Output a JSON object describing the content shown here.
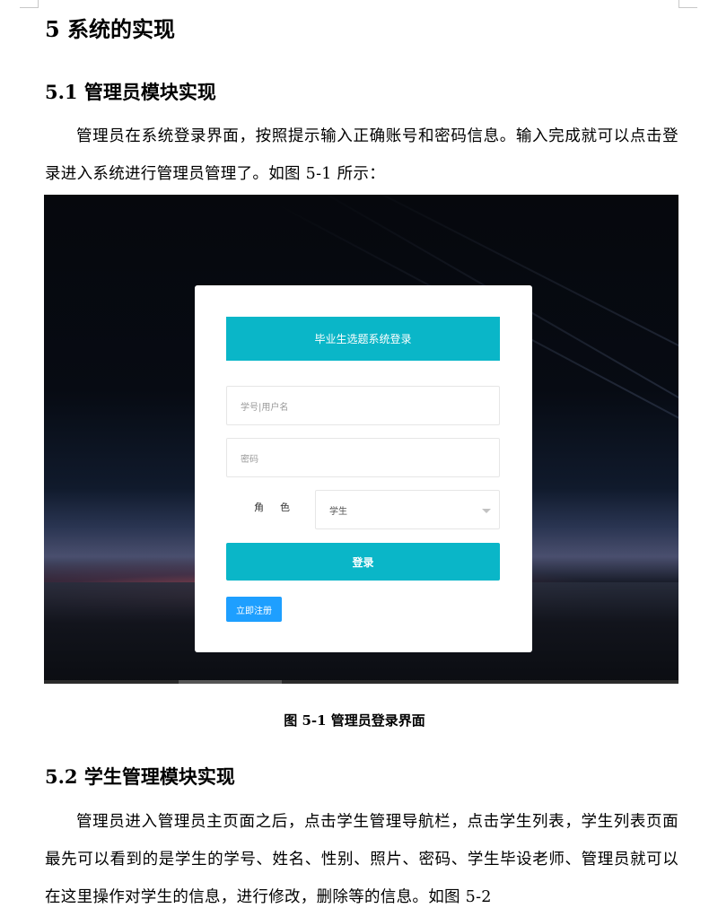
{
  "doc": {
    "h1": "5 系统的实现",
    "sec1_title": "5.1 管理员模块实现",
    "sec1_para": "管理员在系统登录界面，按照提示输入正确账号和密码信息。输入完成就可以点击登录进入系统进行管理员管理了。如图 5-1 所示：",
    "figure_caption": "图 5-1  管理员登录界面",
    "sec2_title": "5.2 学生管理模块实现",
    "sec2_para": "管理员进入管理员主页面之后，点击学生管理导航栏，点击学生列表，学生列表页面最先可以看到的是学生的学号、姓名、性别、照片、密码、学生毕设老师、管理员就可以在这里操作对学生的信息，进行修改，删除等的信息。如图 5-2"
  },
  "login": {
    "title": "毕业生选题系统登录",
    "username_placeholder": "学号|用户名",
    "password_placeholder": "密码",
    "role_label": "角色",
    "role_value": "学生",
    "login_button": "登录",
    "register_button": "立即注册"
  },
  "colors": {
    "accent": "#0ab6c8",
    "register": "#1e9fff"
  }
}
